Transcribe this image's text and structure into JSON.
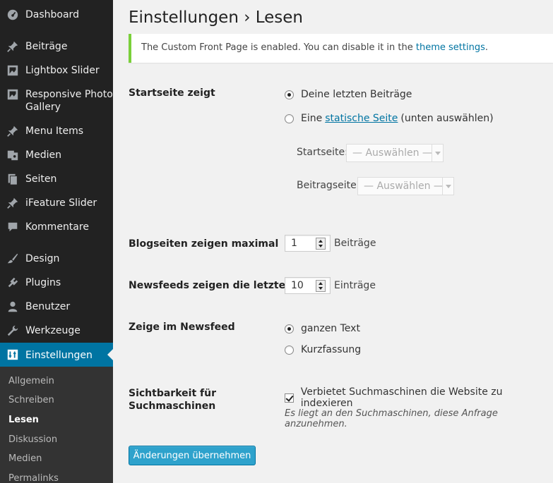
{
  "sidebar": {
    "items": [
      {
        "label": "Dashboard",
        "icon": "dashboard-icon"
      },
      {
        "label": "Beiträge",
        "icon": "pin-icon"
      },
      {
        "label": "Lightbox Slider",
        "icon": "gallery-icon"
      },
      {
        "label": "Responsive Photo Gallery",
        "icon": "gallery-icon"
      },
      {
        "label": "Menu Items",
        "icon": "pin-icon"
      },
      {
        "label": "Medien",
        "icon": "media-icon"
      },
      {
        "label": "Seiten",
        "icon": "pages-icon"
      },
      {
        "label": "iFeature Slider",
        "icon": "pin-icon"
      },
      {
        "label": "Kommentare",
        "icon": "comment-icon"
      },
      {
        "label": "Design",
        "icon": "brush-icon"
      },
      {
        "label": "Plugins",
        "icon": "plugin-icon"
      },
      {
        "label": "Benutzer",
        "icon": "user-icon"
      },
      {
        "label": "Werkzeuge",
        "icon": "wrench-icon"
      },
      {
        "label": "Einstellungen",
        "icon": "settings-icon"
      }
    ],
    "submenu": [
      "Allgemein",
      "Schreiben",
      "Lesen",
      "Diskussion",
      "Medien",
      "Permalinks"
    ],
    "accent_color": "#0074a2"
  },
  "page": {
    "title": "Einstellungen › Lesen"
  },
  "notice": {
    "text_before": "The Custom Front Page is enabled. You can disable it in the ",
    "link": "theme settings",
    "text_after": ".",
    "color": "#7ad03a"
  },
  "front_page": {
    "label": "Startseite zeigt",
    "option_latest": "Deine letzten Beiträge",
    "option_static_before": "Eine",
    "option_static_link": "statische Seite",
    "option_static_after": "(unten auswählen)",
    "startseite_label": "Startseite:",
    "startseite_value": "— Auswählen —",
    "beitragseite_label": "Beitragseite:",
    "beitragseite_value": "— Auswählen —"
  },
  "blog_pages": {
    "label": "Blogseiten zeigen maximal",
    "value": "1",
    "unit": "Beiträge"
  },
  "feeds": {
    "label": "Newsfeeds zeigen die letzten",
    "value": "10",
    "unit": "Einträge"
  },
  "feed_content": {
    "label": "Zeige im Newsfeed",
    "option_full": "ganzen Text",
    "option_summary": "Kurzfassung"
  },
  "visibility": {
    "label_line1": "Sichtbarkeit für",
    "label_line2": "Suchmaschinen",
    "checkbox_label": "Verbietet Suchmaschinen die Website zu indexieren",
    "description": "Es liegt an den Suchmaschinen, diese Anfrage anzunehmen."
  },
  "submit_label": "Änderungen übernehmen"
}
